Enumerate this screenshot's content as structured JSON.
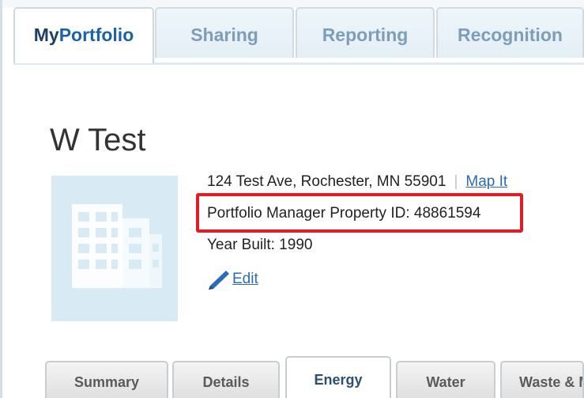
{
  "main_tabs": [
    {
      "label_prefix": "My",
      "label": "Portfolio",
      "active": true
    },
    {
      "label": "Sharing",
      "active": false
    },
    {
      "label": "Reporting",
      "active": false
    },
    {
      "label": "Recognition",
      "active": false
    }
  ],
  "property": {
    "name": "W Test",
    "address": "124 Test Ave, Rochester, MN 55901",
    "separator": "|",
    "map_link": "Map It",
    "pm_id_label": "Portfolio Manager Property ID: 48861594",
    "year_built": "Year Built: 1990",
    "edit_label": "Edit"
  },
  "sub_tabs": [
    {
      "label": "Summary",
      "active": false
    },
    {
      "label": "Details",
      "active": false
    },
    {
      "label": "Energy",
      "active": true
    },
    {
      "label": "Water",
      "active": false
    },
    {
      "label": "Waste & Materials",
      "active": false
    }
  ],
  "colors": {
    "highlight_border": "#e21c24",
    "link": "#2a6cb8",
    "brand_dark": "#1c3f67",
    "brand_blue": "#1c63a6",
    "tab_text": "#7d9eb8",
    "thumbnail_bg": "#d8eaf4"
  },
  "icons": {
    "building": "building-icon",
    "edit": "pencil-icon"
  }
}
